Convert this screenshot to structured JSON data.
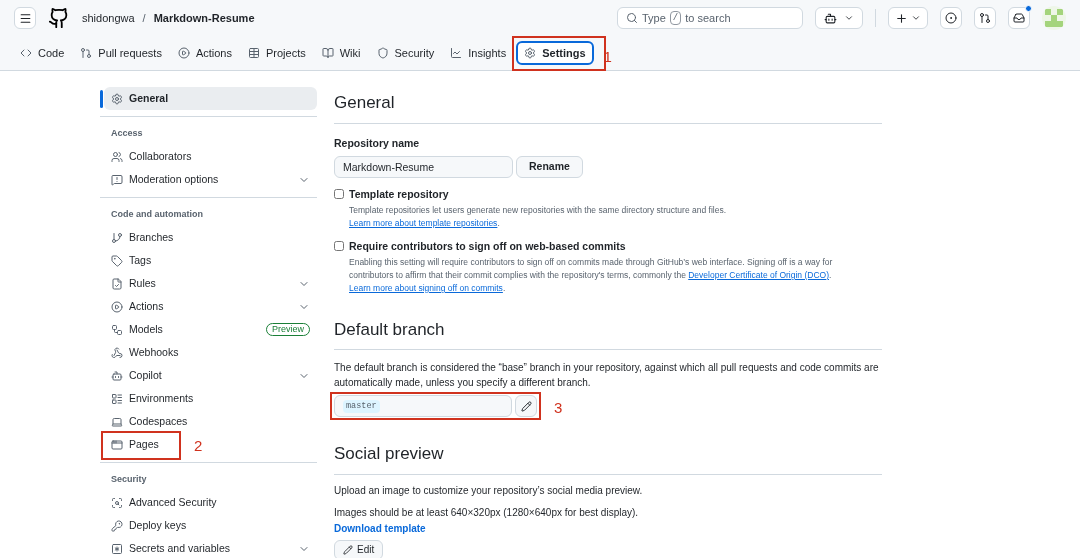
{
  "header": {
    "owner": "shidongwa",
    "separator": "/",
    "repo": "Markdown-Resume",
    "search": {
      "prefix": "Type",
      "key": "/",
      "suffix": "to search"
    },
    "inbox_unread": true
  },
  "tabs": [
    {
      "label": "Code",
      "selected": false
    },
    {
      "label": "Pull requests",
      "selected": false
    },
    {
      "label": "Actions",
      "selected": false
    },
    {
      "label": "Projects",
      "selected": false
    },
    {
      "label": "Wiki",
      "selected": false
    },
    {
      "label": "Security",
      "selected": false
    },
    {
      "label": "Insights",
      "selected": false
    },
    {
      "label": "Settings",
      "selected": true,
      "callout": "1"
    }
  ],
  "sidebar": [
    {
      "items": [
        {
          "label": "General",
          "selected": true,
          "expandable": false
        }
      ]
    },
    {
      "heading": "Access",
      "items": [
        {
          "label": "Collaborators",
          "selected": false,
          "expandable": false
        },
        {
          "label": "Moderation options",
          "selected": false,
          "expandable": true
        }
      ]
    },
    {
      "heading": "Code and automation",
      "items": [
        {
          "label": "Branches",
          "selected": false,
          "expandable": false
        },
        {
          "label": "Tags",
          "selected": false,
          "expandable": false
        },
        {
          "label": "Rules",
          "selected": false,
          "expandable": true
        },
        {
          "label": "Actions",
          "selected": false,
          "expandable": true
        },
        {
          "label": "Models",
          "selected": false,
          "expandable": false,
          "badge": "Preview"
        },
        {
          "label": "Webhooks",
          "selected": false,
          "expandable": false
        },
        {
          "label": "Copilot",
          "selected": false,
          "expandable": true
        },
        {
          "label": "Environments",
          "selected": false,
          "expandable": false
        },
        {
          "label": "Codespaces",
          "selected": false,
          "expandable": false
        },
        {
          "label": "Pages",
          "selected": false,
          "expandable": false,
          "callout": "2"
        }
      ]
    },
    {
      "heading": "Security",
      "items": [
        {
          "label": "Advanced Security",
          "selected": false,
          "expandable": false
        },
        {
          "label": "Deploy keys",
          "selected": false,
          "expandable": false
        },
        {
          "label": "Secrets and variables",
          "selected": false,
          "expandable": true
        }
      ]
    }
  ],
  "general": {
    "title": "General",
    "name_label": "Repository name",
    "name_value": "Markdown-Resume",
    "rename_button": "Rename",
    "options": [
      {
        "label": "Template repository",
        "checked": false,
        "description": [
          {
            "kind": "text",
            "text": "Template repositories let users generate new repositories with the same directory structure and files. "
          },
          {
            "kind": "link",
            "text": "Learn more about template repositories"
          },
          {
            "kind": "text",
            "text": "."
          }
        ]
      },
      {
        "label": "Require contributors to sign off on web-based commits",
        "checked": false,
        "description": [
          {
            "kind": "text",
            "text": "Enabling this setting will require contributors to sign off on commits made through GitHub’s web interface. Signing off is a way for contributors to affirm that their commit complies with the repository's terms, commonly the "
          },
          {
            "kind": "link",
            "text": "Developer Certificate of Origin (DCO)"
          },
          {
            "kind": "text",
            "text": ". "
          },
          {
            "kind": "link",
            "text": "Learn more about signing off on commits"
          },
          {
            "kind": "text",
            "text": "."
          }
        ]
      }
    ]
  },
  "default_branch": {
    "title": "Default branch",
    "description": "The default branch is considered the “base” branch in your repository, against which all pull requests and code commits are automatically made, unless you specify a different branch.",
    "branch": "master",
    "callout": "3"
  },
  "social_preview": {
    "title": "Social preview",
    "lines": [
      "Upload an image to customize your repository’s social media preview.",
      "Images should be at least 640×320px (1280×640px for best display)."
    ],
    "download_link": "Download template",
    "edit_button": "Edit"
  }
}
